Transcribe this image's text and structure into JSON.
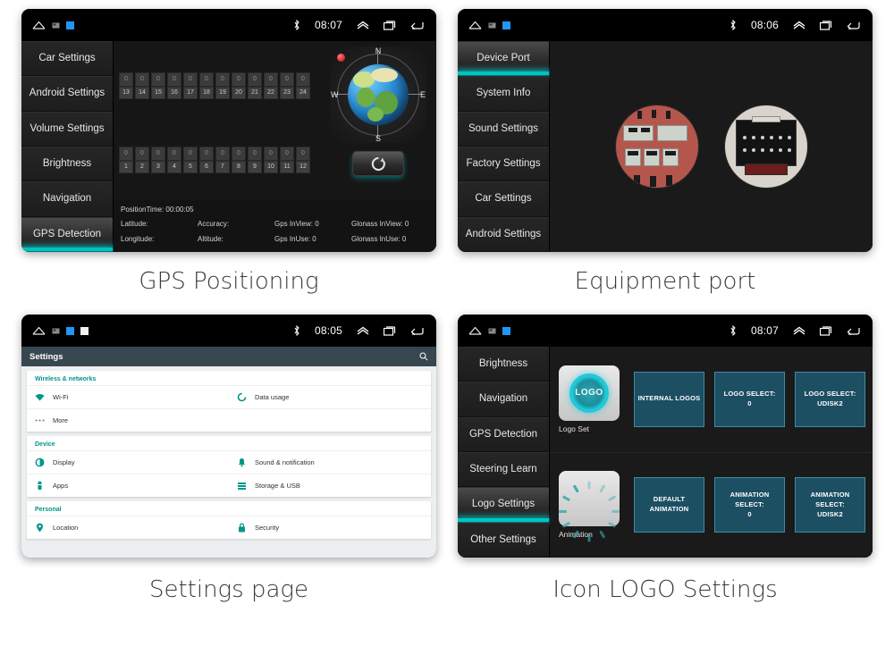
{
  "panels": {
    "gps": {
      "caption": "GPS Positioning",
      "status": {
        "time": "08:07",
        "bluetooth_icon": "bluetooth-icon",
        "up_icon": "chevron-up-icon",
        "recents_icon": "recents-icon",
        "back_icon": "back-icon",
        "home_icon": "home-icon",
        "sd_icon": "sd-card-icon"
      },
      "nav": [
        {
          "label": "Car Settings",
          "selected": false
        },
        {
          "label": "Android Settings",
          "selected": false
        },
        {
          "label": "Volume Settings",
          "selected": false
        },
        {
          "label": "Brightness",
          "selected": false
        },
        {
          "label": "Navigation",
          "selected": false
        },
        {
          "label": "GPS Detection",
          "selected": true
        }
      ],
      "satellites": {
        "top_values": [
          "0",
          "0",
          "0",
          "0",
          "0",
          "0",
          "0",
          "0",
          "0",
          "0",
          "0",
          "0"
        ],
        "top_ids": [
          "13",
          "14",
          "15",
          "16",
          "17",
          "18",
          "19",
          "20",
          "21",
          "22",
          "23",
          "24"
        ],
        "bottom_values": [
          "0",
          "0",
          "0",
          "0",
          "0",
          "0",
          "0",
          "0",
          "0",
          "0",
          "0",
          "0"
        ],
        "bottom_ids": [
          "1",
          "2",
          "3",
          "4",
          "5",
          "6",
          "7",
          "8",
          "9",
          "10",
          "11",
          "12"
        ]
      },
      "compass": {
        "north": "N",
        "south": "S",
        "west": "W",
        "east": "E",
        "refresh_icon": "refresh-icon",
        "led": "status-led"
      },
      "info": {
        "position_time": "PositionTime: 00:00:05",
        "latitude": "Latitude:",
        "accuracy": "Accuracy:",
        "gps_inview": "Gps InView: 0",
        "glonass_inview": "Glonass InView: 0",
        "longitude": "Longitude:",
        "altitude": "Altitude:",
        "gps_inuse": "Gps InUse: 0",
        "glonass_inuse": "Glonass InUse: 0"
      }
    },
    "port": {
      "caption": "Equipment port",
      "status": {
        "time": "08:06"
      },
      "nav": [
        {
          "label": "Device Port",
          "selected": true
        },
        {
          "label": "System Info",
          "selected": false
        },
        {
          "label": "Sound Settings",
          "selected": false
        },
        {
          "label": "Factory Settings",
          "selected": false
        },
        {
          "label": "Car Settings",
          "selected": false
        },
        {
          "label": "Android Settings",
          "selected": false
        }
      ],
      "images": [
        "harness-connector-photo",
        "rear-panel-connector-photo"
      ]
    },
    "settings": {
      "caption": "Settings page",
      "status": {
        "time": "08:05"
      },
      "title": "Settings",
      "search_icon": "search-icon",
      "sections": [
        {
          "label": "Wireless & networks",
          "rows": [
            [
              {
                "label": "Wi-Fi",
                "icon": "wifi-icon"
              },
              {
                "label": "Data usage",
                "icon": "data-usage-icon"
              }
            ],
            [
              {
                "label": "More",
                "icon": "more-icon"
              },
              {
                "label": "",
                "icon": ""
              }
            ]
          ]
        },
        {
          "label": "Device",
          "rows": [
            [
              {
                "label": "Display",
                "icon": "display-icon"
              },
              {
                "label": "Sound & notification",
                "icon": "sound-icon"
              }
            ],
            [
              {
                "label": "Apps",
                "icon": "apps-icon"
              },
              {
                "label": "Storage & USB",
                "icon": "storage-icon"
              }
            ]
          ]
        },
        {
          "label": "Personal",
          "rows": [
            [
              {
                "label": "Location",
                "icon": "location-icon"
              },
              {
                "label": "Security",
                "icon": "lock-icon"
              }
            ]
          ]
        }
      ]
    },
    "logo": {
      "caption": "Icon LOGO Settings",
      "status": {
        "time": "08:07"
      },
      "nav": [
        {
          "label": "Brightness",
          "selected": false
        },
        {
          "label": "Navigation",
          "selected": false
        },
        {
          "label": "GPS Detection",
          "selected": false
        },
        {
          "label": "Steering Learn",
          "selected": false
        },
        {
          "label": "Logo Settings",
          "selected": true
        },
        {
          "label": "Other Settings",
          "selected": false
        }
      ],
      "rows": [
        {
          "preview_caption": "Logo Set",
          "preview_icon": "logo-preview-icon",
          "preview_text": "LOGO",
          "buttons": [
            "INTERNAL LOGOS",
            "LOGO SELECT:\n0",
            "LOGO SELECT:\nUDISK2"
          ]
        },
        {
          "preview_caption": "Animation",
          "preview_icon": "animation-spinner-icon",
          "preview_text": "",
          "buttons": [
            "DEFAULT\nANIMATION",
            "ANIMATION\nSELECT:\n0",
            "ANIMATION\nSELECT:\nUDISK2"
          ]
        }
      ]
    }
  },
  "colors": {
    "accent_teal": "#00c4c4",
    "android_teal": "#009688",
    "button_blue": "#1d4f63",
    "header_slate": "#37474f"
  }
}
